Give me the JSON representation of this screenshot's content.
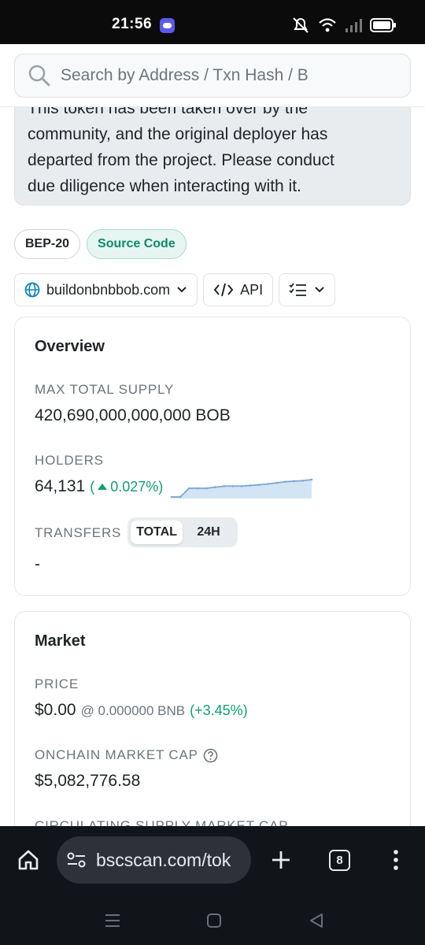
{
  "status": {
    "time": "21:56"
  },
  "search": {
    "placeholder": "Search by Address / Txn Hash / B"
  },
  "warning": {
    "text_lines": [
      "This token has been taken over by the",
      "community, and the original deployer has",
      "departed from the project. Please conduct",
      "due diligence when interacting with it."
    ]
  },
  "badges": {
    "standard": "BEP-20",
    "source_code": "Source Code"
  },
  "actions": {
    "website": "buildonbnbbob.com",
    "api": "API"
  },
  "overview": {
    "title": "Overview",
    "max_supply_label": "MAX TOTAL SUPPLY",
    "max_supply_value": "420,690,000,000,000 BOB",
    "holders_label": "HOLDERS",
    "holders_value": "64,131",
    "holders_change": "0.027%",
    "holders_trend": [
      1,
      1,
      5,
      5,
      5,
      5.5,
      6,
      6,
      6,
      6.3,
      6.6,
      7,
      7.5,
      8,
      8.3,
      8.5,
      9
    ],
    "transfers_label": "TRANSFERS",
    "transfers_tabs": [
      "TOTAL",
      "24H"
    ],
    "transfers_value": "-"
  },
  "market": {
    "title": "Market",
    "price_label": "PRICE",
    "price_value": "$0.00",
    "price_bnb": "@ 0.000000 BNB",
    "price_change": "(+3.45%)",
    "mcap_label": "ONCHAIN MARKET CAP",
    "mcap_value": "$5,082,776.58",
    "circ_label": "CIRCULATING SUPPLY MARKET CAP"
  },
  "browser": {
    "url": "bscscan.com/tok",
    "tab_count": "8"
  },
  "colors": {
    "accent_green": "#0d9f75",
    "chart_line": "#7aa7d6",
    "chart_fill": "#d3e4f5"
  }
}
